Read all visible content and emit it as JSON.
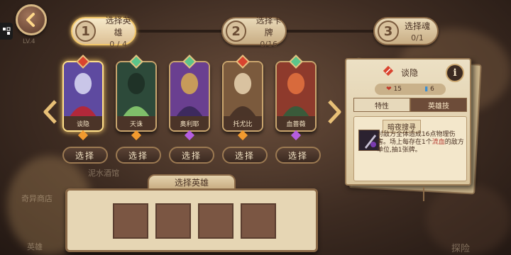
{
  "steps": [
    {
      "num": "1",
      "title": "选择英雄",
      "count": "0 / 4"
    },
    {
      "num": "2",
      "title": "选择卡牌",
      "count": "0/16"
    },
    {
      "num": "3",
      "title": "选择魂",
      "count": "0/1"
    }
  ],
  "heroes": [
    {
      "name": "谈隐",
      "selected": true,
      "gem": "#d9442f",
      "rarity": "#f29a2e"
    },
    {
      "name": "天诛",
      "selected": false,
      "gem": "#5cc48a",
      "rarity": "#f29a2e"
    },
    {
      "name": "奥利耶",
      "selected": false,
      "gem": "#5cc48a",
      "rarity": "#b55de0"
    },
    {
      "name": "托尤比",
      "selected": false,
      "gem": "#d9442f",
      "rarity": "#f29a2e"
    },
    {
      "name": "血蔷薇",
      "selected": false,
      "gem": "#5cc48a",
      "rarity": "#b55de0"
    }
  ],
  "select_label": "选择",
  "select_panel": {
    "label": "选择英雄"
  },
  "info_card": {
    "hero_name": "谈隐",
    "info_glyph": "i",
    "hp": "15",
    "cost": "6",
    "tabs": [
      "特性",
      "英雄技"
    ],
    "active_tab": "英雄技",
    "skill_name": "暗夜搜寻",
    "skill_desc_1": "对敌方全体造成16点物理伤害。场上每存在1个",
    "skill_desc_red": "流血",
    "skill_desc_2": "的敌方单位,抽1张牌。"
  },
  "background_texts": [
    "LV.4",
    "奇异商店",
    "泥水酒馆",
    "探险",
    "英雄"
  ]
}
